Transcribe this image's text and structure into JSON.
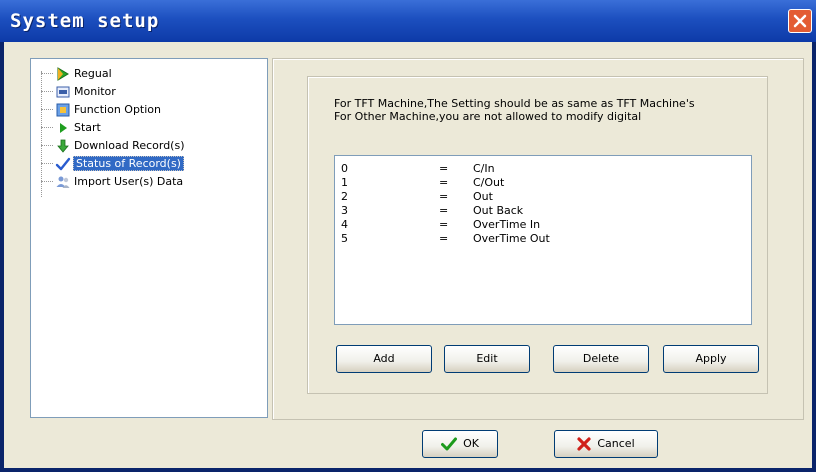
{
  "window": {
    "title": "System setup"
  },
  "tree": {
    "items": [
      {
        "label": "Regual",
        "icon": "green-arrow-icon"
      },
      {
        "label": "Monitor",
        "icon": "monitor-icon"
      },
      {
        "label": "Function Option",
        "icon": "function-option-icon"
      },
      {
        "label": "Start",
        "icon": "start-icon"
      },
      {
        "label": "Download Record(s)",
        "icon": "download-icon"
      },
      {
        "label": "Status of Record(s)",
        "icon": "checkmark-icon",
        "selected": true
      },
      {
        "label": "Import User(s) Data",
        "icon": "users-icon"
      }
    ]
  },
  "notice": {
    "line1": "For TFT Machine,The Setting should be as same as TFT Machine's",
    "line2": "For Other Machine,you are not  allowed to modify digital"
  },
  "records": [
    {
      "code": "0",
      "eq": "=",
      "status": "C/In"
    },
    {
      "code": "1",
      "eq": "=",
      "status": "C/Out"
    },
    {
      "code": "2",
      "eq": "=",
      "status": "Out"
    },
    {
      "code": "3",
      "eq": "=",
      "status": "Out Back"
    },
    {
      "code": "4",
      "eq": "=",
      "status": "OverTime In"
    },
    {
      "code": "5",
      "eq": "=",
      "status": "OverTime Out"
    }
  ],
  "buttons": {
    "add": "Add",
    "edit": "Edit",
    "delete": "Delete",
    "apply": "Apply",
    "ok": "OK",
    "cancel": "Cancel"
  },
  "colors": {
    "titlebar": "#1c4fbf",
    "selection": "#316ac5",
    "close": "#e35c34",
    "face": "#ece9d8"
  }
}
